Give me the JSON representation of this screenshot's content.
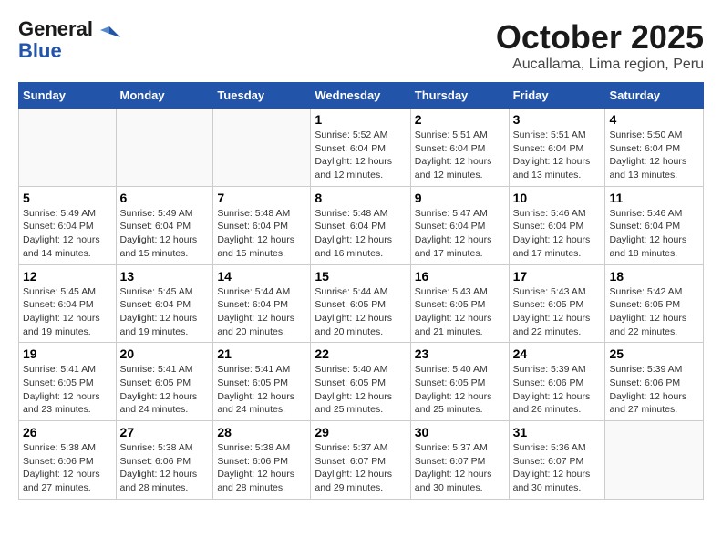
{
  "header": {
    "logo_line1": "General",
    "logo_line2": "Blue",
    "month": "October 2025",
    "location": "Aucallama, Lima region, Peru"
  },
  "weekdays": [
    "Sunday",
    "Monday",
    "Tuesday",
    "Wednesday",
    "Thursday",
    "Friday",
    "Saturday"
  ],
  "weeks": [
    [
      {
        "day": "",
        "info": ""
      },
      {
        "day": "",
        "info": ""
      },
      {
        "day": "",
        "info": ""
      },
      {
        "day": "1",
        "info": "Sunrise: 5:52 AM\nSunset: 6:04 PM\nDaylight: 12 hours\nand 12 minutes."
      },
      {
        "day": "2",
        "info": "Sunrise: 5:51 AM\nSunset: 6:04 PM\nDaylight: 12 hours\nand 12 minutes."
      },
      {
        "day": "3",
        "info": "Sunrise: 5:51 AM\nSunset: 6:04 PM\nDaylight: 12 hours\nand 13 minutes."
      },
      {
        "day": "4",
        "info": "Sunrise: 5:50 AM\nSunset: 6:04 PM\nDaylight: 12 hours\nand 13 minutes."
      }
    ],
    [
      {
        "day": "5",
        "info": "Sunrise: 5:49 AM\nSunset: 6:04 PM\nDaylight: 12 hours\nand 14 minutes."
      },
      {
        "day": "6",
        "info": "Sunrise: 5:49 AM\nSunset: 6:04 PM\nDaylight: 12 hours\nand 15 minutes."
      },
      {
        "day": "7",
        "info": "Sunrise: 5:48 AM\nSunset: 6:04 PM\nDaylight: 12 hours\nand 15 minutes."
      },
      {
        "day": "8",
        "info": "Sunrise: 5:48 AM\nSunset: 6:04 PM\nDaylight: 12 hours\nand 16 minutes."
      },
      {
        "day": "9",
        "info": "Sunrise: 5:47 AM\nSunset: 6:04 PM\nDaylight: 12 hours\nand 17 minutes."
      },
      {
        "day": "10",
        "info": "Sunrise: 5:46 AM\nSunset: 6:04 PM\nDaylight: 12 hours\nand 17 minutes."
      },
      {
        "day": "11",
        "info": "Sunrise: 5:46 AM\nSunset: 6:04 PM\nDaylight: 12 hours\nand 18 minutes."
      }
    ],
    [
      {
        "day": "12",
        "info": "Sunrise: 5:45 AM\nSunset: 6:04 PM\nDaylight: 12 hours\nand 19 minutes."
      },
      {
        "day": "13",
        "info": "Sunrise: 5:45 AM\nSunset: 6:04 PM\nDaylight: 12 hours\nand 19 minutes."
      },
      {
        "day": "14",
        "info": "Sunrise: 5:44 AM\nSunset: 6:04 PM\nDaylight: 12 hours\nand 20 minutes."
      },
      {
        "day": "15",
        "info": "Sunrise: 5:44 AM\nSunset: 6:05 PM\nDaylight: 12 hours\nand 20 minutes."
      },
      {
        "day": "16",
        "info": "Sunrise: 5:43 AM\nSunset: 6:05 PM\nDaylight: 12 hours\nand 21 minutes."
      },
      {
        "day": "17",
        "info": "Sunrise: 5:43 AM\nSunset: 6:05 PM\nDaylight: 12 hours\nand 22 minutes."
      },
      {
        "day": "18",
        "info": "Sunrise: 5:42 AM\nSunset: 6:05 PM\nDaylight: 12 hours\nand 22 minutes."
      }
    ],
    [
      {
        "day": "19",
        "info": "Sunrise: 5:41 AM\nSunset: 6:05 PM\nDaylight: 12 hours\nand 23 minutes."
      },
      {
        "day": "20",
        "info": "Sunrise: 5:41 AM\nSunset: 6:05 PM\nDaylight: 12 hours\nand 24 minutes."
      },
      {
        "day": "21",
        "info": "Sunrise: 5:41 AM\nSunset: 6:05 PM\nDaylight: 12 hours\nand 24 minutes."
      },
      {
        "day": "22",
        "info": "Sunrise: 5:40 AM\nSunset: 6:05 PM\nDaylight: 12 hours\nand 25 minutes."
      },
      {
        "day": "23",
        "info": "Sunrise: 5:40 AM\nSunset: 6:05 PM\nDaylight: 12 hours\nand 25 minutes."
      },
      {
        "day": "24",
        "info": "Sunrise: 5:39 AM\nSunset: 6:06 PM\nDaylight: 12 hours\nand 26 minutes."
      },
      {
        "day": "25",
        "info": "Sunrise: 5:39 AM\nSunset: 6:06 PM\nDaylight: 12 hours\nand 27 minutes."
      }
    ],
    [
      {
        "day": "26",
        "info": "Sunrise: 5:38 AM\nSunset: 6:06 PM\nDaylight: 12 hours\nand 27 minutes."
      },
      {
        "day": "27",
        "info": "Sunrise: 5:38 AM\nSunset: 6:06 PM\nDaylight: 12 hours\nand 28 minutes."
      },
      {
        "day": "28",
        "info": "Sunrise: 5:38 AM\nSunset: 6:06 PM\nDaylight: 12 hours\nand 28 minutes."
      },
      {
        "day": "29",
        "info": "Sunrise: 5:37 AM\nSunset: 6:07 PM\nDaylight: 12 hours\nand 29 minutes."
      },
      {
        "day": "30",
        "info": "Sunrise: 5:37 AM\nSunset: 6:07 PM\nDaylight: 12 hours\nand 30 minutes."
      },
      {
        "day": "31",
        "info": "Sunrise: 5:36 AM\nSunset: 6:07 PM\nDaylight: 12 hours\nand 30 minutes."
      },
      {
        "day": "",
        "info": ""
      }
    ]
  ]
}
